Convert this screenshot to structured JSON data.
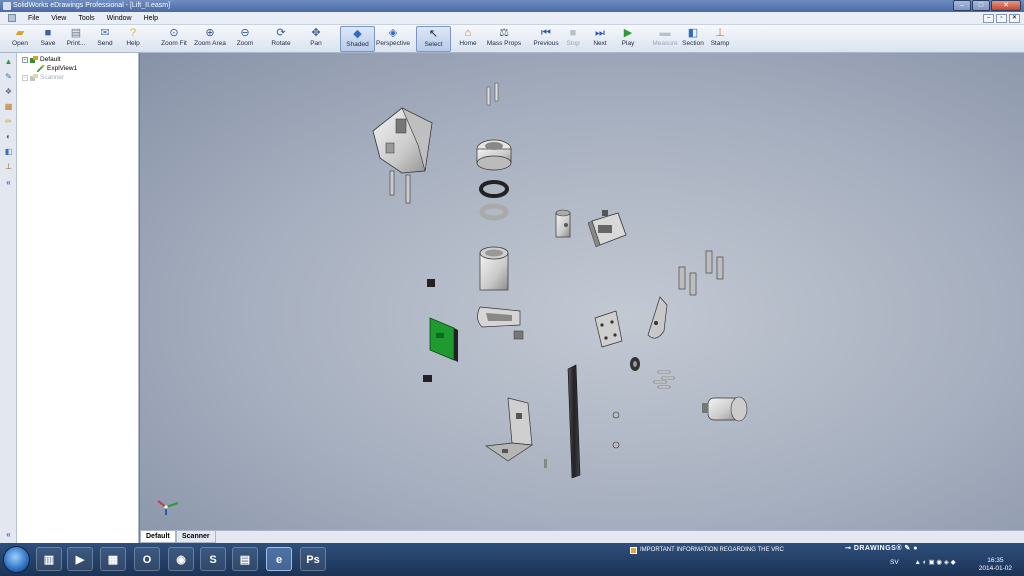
{
  "window": {
    "title": "SolidWorks eDrawings Professional - [Lift_II.easm]"
  },
  "menu": [
    "File",
    "View",
    "Tools",
    "Window",
    "Help"
  ],
  "toolbar": {
    "open": "Open",
    "save": "Save",
    "print": "Print...",
    "send": "Send",
    "help": "Help",
    "zoom_fit": "Zoom Fit",
    "zoom_area": "Zoom Area",
    "zoom": "Zoom",
    "rotate": "Rotate",
    "pan": "Pan",
    "shaded": "Shaded",
    "perspective": "Perspective",
    "select": "Select",
    "home": "Home",
    "mass_props": "Mass Props",
    "previous": "Previous",
    "stop": "Stop",
    "next": "Next",
    "play": "Play",
    "measure": "Measure",
    "section": "Section",
    "stamp": "Stamp"
  },
  "tree": {
    "root": "Default",
    "child": "ExplView1",
    "second": "Scanner"
  },
  "tabs": [
    "Default",
    "Scanner"
  ],
  "taskbar": {
    "notification": "IMPORTANT INFORMATION REGARDING THE VRC",
    "brand": "DRAWINGS®",
    "lang": "SV",
    "time": "16:35",
    "date": "2014-01-02"
  },
  "colors": {
    "accent": "#4a6aa6",
    "pcb": "#1f9a2e",
    "part": "#d8d8d8"
  }
}
